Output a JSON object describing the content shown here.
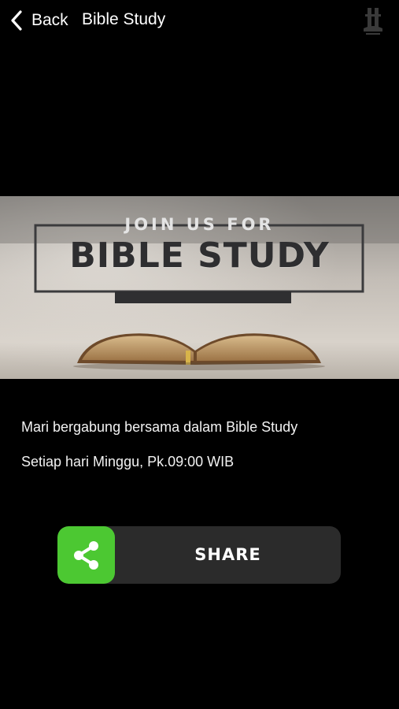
{
  "nav": {
    "back_label": "Back",
    "title": "Bible Study",
    "back_icon": "chevron-left-icon",
    "logo_icon": "church-logo-icon"
  },
  "banner": {
    "kicker": "JOIN US FOR",
    "headline": "BIBLE STUDY"
  },
  "content": {
    "lines": [
      "Mari bergabung bersama dalam Bible Study",
      "Setiap hari Minggu, Pk.09:00 WIB"
    ]
  },
  "share": {
    "label": "SHARE",
    "icon": "share-icon",
    "accent": "#4cc832"
  }
}
